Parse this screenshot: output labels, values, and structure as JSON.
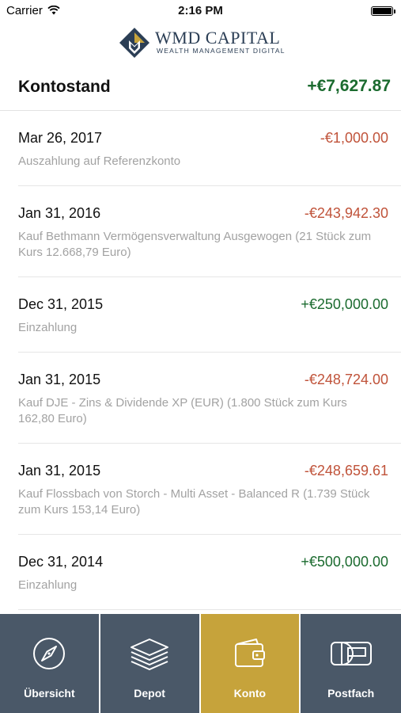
{
  "status_bar": {
    "carrier": "Carrier",
    "time": "2:16 PM"
  },
  "header": {
    "brand": "WMD CAPITAL",
    "tagline": "WEALTH MANAGEMENT DIGITAL"
  },
  "balance": {
    "label": "Kontostand",
    "value": "+€7,627.87"
  },
  "transactions": [
    {
      "date": "Mar 26, 2017",
      "amount": "-€1,000.00",
      "sign": "negative",
      "description": "Auszahlung auf Referenzkonto"
    },
    {
      "date": "Jan 31, 2016",
      "amount": "-€243,942.30",
      "sign": "negative",
      "description": "Kauf Bethmann Vermögensverwaltung Ausgewogen (21 Stück zum Kurs 12.668,79 Euro)"
    },
    {
      "date": "Dec 31, 2015",
      "amount": "+€250,000.00",
      "sign": "positive",
      "description": "Einzahlung"
    },
    {
      "date": "Jan 31, 2015",
      "amount": "-€248,724.00",
      "sign": "negative",
      "description": "Kauf DJE - Zins & Dividende XP (EUR) (1.800 Stück zum Kurs 162,80 Euro)"
    },
    {
      "date": "Jan 31, 2015",
      "amount": "-€248,659.61",
      "sign": "negative",
      "description": "Kauf Flossbach von Storch - Multi Asset - Balanced R (1.739 Stück zum Kurs 153,14 Euro)"
    },
    {
      "date": "Dec 31, 2014",
      "amount": "+€500,000.00",
      "sign": "positive",
      "description": "Einzahlung"
    }
  ],
  "tabs": [
    {
      "label": "Übersicht",
      "icon": "compass-icon",
      "active": false
    },
    {
      "label": "Depot",
      "icon": "layers-icon",
      "active": false
    },
    {
      "label": "Konto",
      "icon": "wallet-icon",
      "active": true
    },
    {
      "label": "Postfach",
      "icon": "mailbox-icon",
      "active": false
    }
  ],
  "colors": {
    "positive": "#1b6b2f",
    "negative": "#c0533a",
    "tabbar": "#4a5868",
    "tab_active": "#c6a33b",
    "brand": "#2b3e55"
  }
}
